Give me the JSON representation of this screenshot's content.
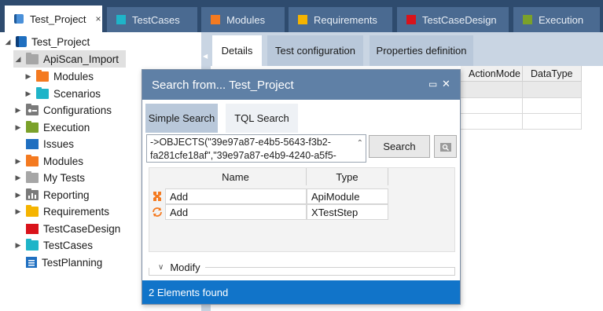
{
  "tabs": [
    {
      "label": "Test_Project",
      "color": "#4a90d9",
      "icon": "project-icon",
      "closable": true
    },
    {
      "label": "TestCases",
      "color": "#1fb4c8",
      "icon": "folder-icon"
    },
    {
      "label": "Modules",
      "color": "#f47a20",
      "icon": "folder-icon"
    },
    {
      "label": "Requirements",
      "color": "#f5b400",
      "icon": "folder-icon"
    },
    {
      "label": "TestCaseDesign",
      "color": "#d9131b",
      "icon": "folder-icon"
    },
    {
      "label": "Execution",
      "color": "#7ba12a",
      "icon": "folder-icon"
    }
  ],
  "tab_close_glyph": "×",
  "tree": [
    {
      "label": "Test_Project",
      "icon": "project-icon",
      "expander": "◢",
      "color": "#1f6fc0"
    },
    {
      "label": "ApiScan_Import",
      "icon": "folder-icon",
      "expander": "◢",
      "color": "#a6a6a6",
      "selected": true
    },
    {
      "label": "Modules",
      "icon": "folder-icon",
      "expander": "▶",
      "color": "#f47a20"
    },
    {
      "label": "Scenarios",
      "icon": "folder-icon",
      "expander": "▶",
      "color": "#1fb4c8"
    },
    {
      "label": "Configurations",
      "icon": "configurations-icon",
      "expander": "▶",
      "color": "#7a7a7a"
    },
    {
      "label": "Execution",
      "icon": "folder-icon",
      "expander": "▶",
      "color": "#7ba12a"
    },
    {
      "label": "Issues",
      "icon": "folder-icon",
      "expander": "",
      "color": "#1f6fc0"
    },
    {
      "label": "Modules",
      "icon": "folder-icon",
      "expander": "▶",
      "color": "#f47a20"
    },
    {
      "label": "My Tests",
      "icon": "folder-icon",
      "expander": "▶",
      "color": "#a6a6a6"
    },
    {
      "label": "Reporting",
      "icon": "reporting-icon",
      "expander": "▶",
      "color": "#7a7a7a"
    },
    {
      "label": "Requirements",
      "icon": "folder-icon",
      "expander": "▶",
      "color": "#f5b400"
    },
    {
      "label": "TestCaseDesign",
      "icon": "folder-icon",
      "expander": "",
      "color": "#d9131b"
    },
    {
      "label": "TestCases",
      "icon": "folder-icon",
      "expander": "▶",
      "color": "#1fb4c8"
    },
    {
      "label": "TestPlanning",
      "icon": "testplanning-icon",
      "expander": "",
      "color": "#1f6fc0"
    }
  ],
  "details": {
    "tabs": [
      "Details",
      "Test configuration",
      "Properties definition"
    ],
    "columns": [
      "ActionMode",
      "DataType"
    ]
  },
  "dialog": {
    "title": "Search from... Test_Project",
    "tabs": [
      "Simple Search",
      "TQL Search"
    ],
    "query_line1": "->OBJECTS(\"39e97a87-e4b5-5643-f3b2-",
    "query_line2": "fa281cfe18af\",\"39e97a87-e4b9-4240-a5f5-",
    "search_button": "Search",
    "columns": [
      "Name",
      "Type"
    ],
    "rows": [
      {
        "name": "Add",
        "type": "ApiModule",
        "icon": "apimodule-icon",
        "icon_color": "#f47a20"
      },
      {
        "name": "Add",
        "type": "XTestStep",
        "icon": "xteststep-icon",
        "icon_color": "#f47a20"
      }
    ],
    "modify_label": "Modify",
    "status": "2 Elements found"
  }
}
